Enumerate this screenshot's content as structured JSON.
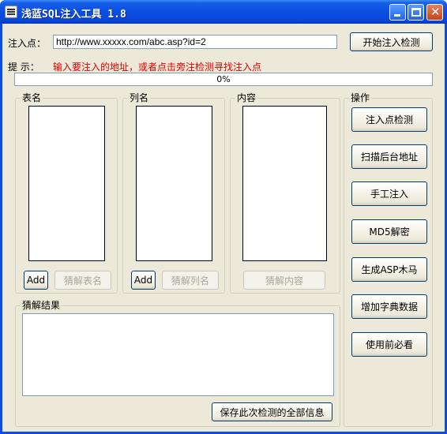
{
  "window": {
    "title": "浅蓝SQL注入工具 1.8",
    "controls": {
      "minimize": "minimize-icon",
      "maximize": "maximize-icon",
      "close": "close-icon"
    }
  },
  "url_row": {
    "label": "注入点：",
    "value": "http://www.xxxxx.com/abc.asp?id=2",
    "start_button": "开始注入检测"
  },
  "hint_row": {
    "label": "提 示：",
    "text": "输入要注入的地址，或者点击旁注检测寻找注入点",
    "color": "#e00000"
  },
  "progress": {
    "value": 0,
    "text": "0%"
  },
  "tables_group": {
    "title": "表名",
    "add": "Add",
    "guess": "猜解表名",
    "items": []
  },
  "columns_group": {
    "title": "列名",
    "add": "Add",
    "guess": "猜解列名",
    "items": []
  },
  "content_group": {
    "title": "内容",
    "guess": "猜解内容",
    "items": []
  },
  "result_group": {
    "title": "猜解结果",
    "save": "保存此次检测的全部信息",
    "text": ""
  },
  "actions_group": {
    "title": "操作",
    "buttons": [
      "注入点检测",
      "扫描后台地址",
      "手工注入",
      "MD5解密",
      "生成ASP木马",
      "增加字典数据",
      "使用前必看"
    ]
  },
  "colors": {
    "titlebar": "#0a4ee3",
    "client": "#ece9d8",
    "hint": "#e00000"
  }
}
